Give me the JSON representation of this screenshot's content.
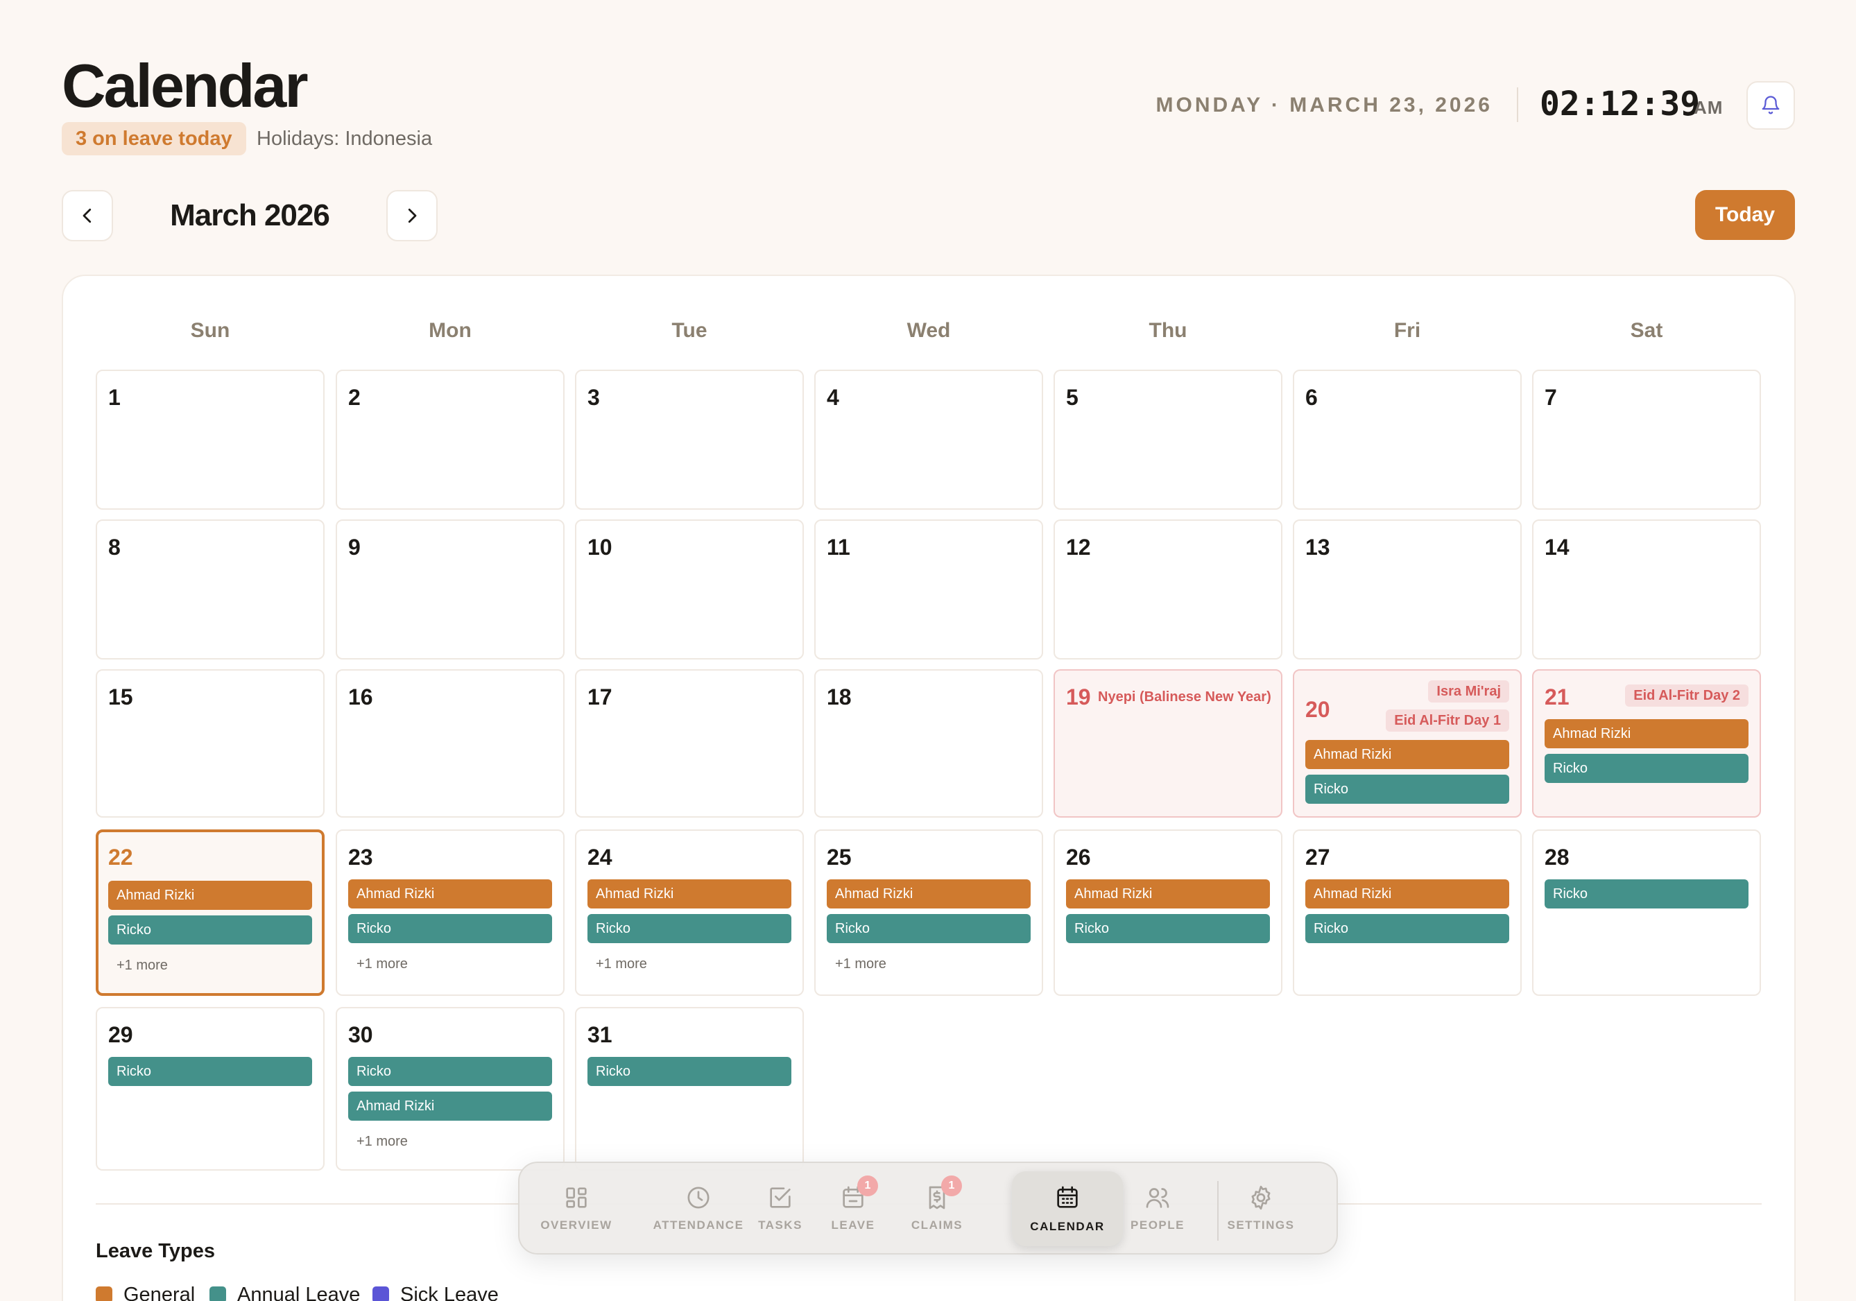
{
  "header": {
    "title": "Calendar",
    "leave_badge": "3 on leave today",
    "holidays": "Holidays: Indonesia",
    "date": "MONDAY · MARCH 23, 2026",
    "time": "02:12:39",
    "ampm": "AM",
    "bell_icon": "bell-icon"
  },
  "month_nav": {
    "prev_icon": "chevron-left-icon",
    "next_icon": "chevron-right-icon",
    "month": "March 2026",
    "today_label": "Today"
  },
  "weekdays": [
    "Sun",
    "Mon",
    "Tue",
    "Wed",
    "Thu",
    "Fri",
    "Sat"
  ],
  "calendar": {
    "today_day": 22,
    "days": {
      "19": {
        "holidays": [
          "Nyepi (Balinese New Year)"
        ],
        "events": []
      },
      "20": {
        "holidays": [
          "Isra Mi'raj",
          "Eid Al-Fitr Day 1"
        ],
        "events": [
          {
            "name": "Ahmad Rizki",
            "type": "general"
          },
          {
            "name": "Ricko",
            "type": "annual"
          }
        ]
      },
      "21": {
        "holidays": [
          "Eid Al-Fitr Day 2"
        ],
        "events": [
          {
            "name": "Ahmad Rizki",
            "type": "general"
          },
          {
            "name": "Ricko",
            "type": "annual"
          }
        ]
      },
      "22": {
        "events": [
          {
            "name": "Ahmad Rizki",
            "type": "general"
          },
          {
            "name": "Ricko",
            "type": "annual"
          }
        ],
        "more": "+1 more"
      },
      "23": {
        "events": [
          {
            "name": "Ahmad Rizki",
            "type": "general"
          },
          {
            "name": "Ricko",
            "type": "annual"
          }
        ],
        "more": "+1 more"
      },
      "24": {
        "events": [
          {
            "name": "Ahmad Rizki",
            "type": "general"
          },
          {
            "name": "Ricko",
            "type": "annual"
          }
        ],
        "more": "+1 more"
      },
      "25": {
        "events": [
          {
            "name": "Ahmad Rizki",
            "type": "general"
          },
          {
            "name": "Ricko",
            "type": "annual"
          }
        ],
        "more": "+1 more"
      },
      "26": {
        "events": [
          {
            "name": "Ahmad Rizki",
            "type": "general"
          },
          {
            "name": "Ricko",
            "type": "annual"
          }
        ]
      },
      "27": {
        "events": [
          {
            "name": "Ahmad Rizki",
            "type": "general"
          },
          {
            "name": "Ricko",
            "type": "annual"
          }
        ]
      },
      "28": {
        "events": [
          {
            "name": "Ricko",
            "type": "annual"
          }
        ]
      },
      "29": {
        "events": [
          {
            "name": "Ricko",
            "type": "annual"
          }
        ]
      },
      "30": {
        "events": [
          {
            "name": "Ricko",
            "type": "annual"
          },
          {
            "name": "Ahmad Rizki",
            "type": "annual"
          }
        ],
        "more": "+1 more"
      },
      "31": {
        "events": [
          {
            "name": "Ricko",
            "type": "annual"
          }
        ]
      }
    }
  },
  "legend": {
    "title": "Leave Types",
    "items": [
      {
        "label": "General",
        "color": "#cf7a2f"
      },
      {
        "label": "Annual Leave",
        "color": "#44918a"
      },
      {
        "label": "Sick Leave",
        "color": "#5b55d6"
      }
    ]
  },
  "dock": {
    "items": [
      {
        "label": "OVERVIEW",
        "icon": "grid-icon"
      },
      {
        "label": "ATTENDANCE",
        "icon": "clock-icon"
      },
      {
        "label": "TASKS",
        "icon": "checkbox-icon"
      },
      {
        "label": "LEAVE",
        "icon": "calendar-minus-icon",
        "badge": "1"
      },
      {
        "label": "CLAIMS",
        "icon": "receipt-icon",
        "badge": "1"
      },
      {
        "label": "CALENDAR",
        "icon": "calendar-icon",
        "active": true
      },
      {
        "label": "PEOPLE",
        "icon": "people-icon"
      },
      {
        "label": "SETTINGS",
        "icon": "gear-icon"
      }
    ]
  },
  "colors": {
    "accent": "#cf7a2f",
    "annual": "#44918a",
    "holiday": "#d65a5a"
  }
}
